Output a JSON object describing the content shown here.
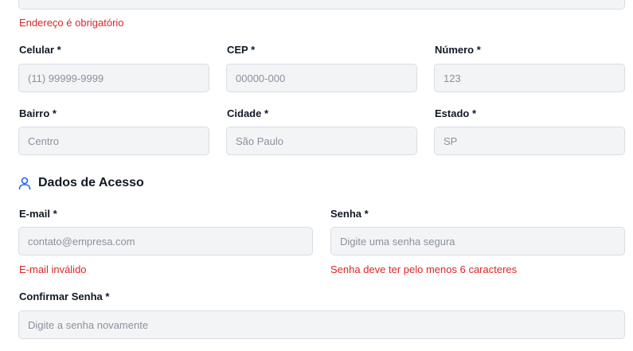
{
  "address": {
    "error": "Endereço é obrigatório"
  },
  "fields": {
    "celular": {
      "label": "Celular *",
      "placeholder": "(11) 99999-9999"
    },
    "cep": {
      "label": "CEP *",
      "placeholder": "00000-000"
    },
    "numero": {
      "label": "Número *",
      "placeholder": "123"
    },
    "bairro": {
      "label": "Bairro *",
      "placeholder": "Centro"
    },
    "cidade": {
      "label": "Cidade *",
      "placeholder": "São Paulo"
    },
    "estado": {
      "label": "Estado *",
      "placeholder": "SP"
    }
  },
  "access": {
    "title": "Dados de Acesso",
    "icon": "user-icon",
    "accent_color": "#2563eb",
    "email": {
      "label": "E-mail *",
      "placeholder": "contato@empresa.com",
      "error": "E-mail inválido"
    },
    "senha": {
      "label": "Senha *",
      "placeholder": "Digite uma senha segura",
      "error": "Senha deve ter pelo menos 6 caracteres"
    },
    "confirmar": {
      "label": "Confirmar Senha *",
      "placeholder": "Digite a senha novamente"
    }
  },
  "colors": {
    "error": "#dc2626",
    "input_bg": "#f3f4f6",
    "input_border": "#d9dde3"
  }
}
